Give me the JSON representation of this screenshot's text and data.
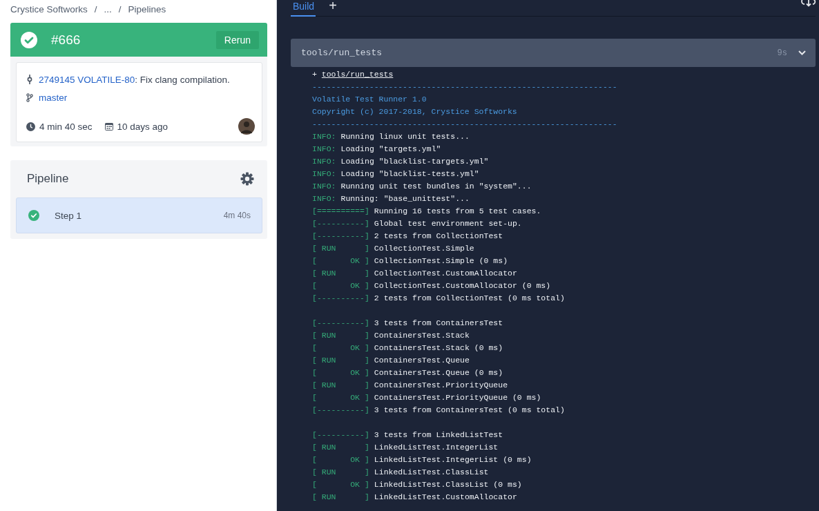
{
  "breadcrumb": [
    "Crystice Softworks",
    "/",
    "...",
    "/",
    "Pipelines"
  ],
  "build": {
    "succeeded": true,
    "number": "#666",
    "rerun": "Rerun",
    "commit_link": "2749145 VOLATILE-80",
    "commit_message": ": Fix clang compilation.",
    "branch": "master",
    "duration": "4 min 40 sec",
    "created": "10 days ago"
  },
  "pipeline": {
    "title": "Pipeline",
    "steps": [
      {
        "name": "Step 1",
        "duration": "4m 40s",
        "succeeded": true,
        "selected": true
      }
    ]
  },
  "tabs": [
    {
      "label": "Build",
      "selected": true
    }
  ],
  "add_tab": "+",
  "section": {
    "command": "tools/run_tests",
    "duration": "9s",
    "expanded": true
  },
  "log": [
    {
      "kind": "command",
      "prefix": "+",
      "text": "tools/run_tests"
    },
    {
      "kind": "rule",
      "text": "----------------------------------------------------------------"
    },
    {
      "kind": "header",
      "text": "Volatile Test Runner 1.0"
    },
    {
      "kind": "header",
      "text": "Copyright (c) 2017-2018, Crystice Softworks"
    },
    {
      "kind": "rule",
      "text": "----------------------------------------------------------------"
    },
    {
      "kind": "info",
      "prefix": "INFO:",
      "text": "Running linux unit tests..."
    },
    {
      "kind": "info",
      "prefix": "INFO:",
      "text": "Loading \"targets.yml\""
    },
    {
      "kind": "info",
      "prefix": "INFO:",
      "text": "Loading \"blacklist-targets.yml\""
    },
    {
      "kind": "info",
      "prefix": "INFO:",
      "text": "Loading \"blacklist-tests.yml\""
    },
    {
      "kind": "info",
      "prefix": "INFO:",
      "text": "Running unit test bundles in \"system\"..."
    },
    {
      "kind": "info",
      "prefix": "INFO:",
      "text": "Running: \"base_unittest\"..."
    },
    {
      "kind": "gtest",
      "prefix": "[==========]",
      "text": "Running 16 tests from 5 test cases."
    },
    {
      "kind": "gtest",
      "prefix": "[----------]",
      "text": "Global test environment set-up."
    },
    {
      "kind": "gtest",
      "prefix": "[----------]",
      "text": "2 tests from CollectionTest"
    },
    {
      "kind": "gtest",
      "prefix": "[ RUN      ]",
      "text": "CollectionTest.Simple"
    },
    {
      "kind": "gtest",
      "prefix": "[       OK ]",
      "text": "CollectionTest.Simple (0 ms)"
    },
    {
      "kind": "gtest",
      "prefix": "[ RUN      ]",
      "text": "CollectionTest.CustomAllocator"
    },
    {
      "kind": "gtest",
      "prefix": "[       OK ]",
      "text": "CollectionTest.CustomAllocator (0 ms)"
    },
    {
      "kind": "gtest",
      "prefix": "[----------]",
      "text": "2 tests from CollectionTest (0 ms total)"
    },
    {
      "kind": "blank"
    },
    {
      "kind": "gtest",
      "prefix": "[----------]",
      "text": "3 tests from ContainersTest"
    },
    {
      "kind": "gtest",
      "prefix": "[ RUN      ]",
      "text": "ContainersTest.Stack"
    },
    {
      "kind": "gtest",
      "prefix": "[       OK ]",
      "text": "ContainersTest.Stack (0 ms)"
    },
    {
      "kind": "gtest",
      "prefix": "[ RUN      ]",
      "text": "ContainersTest.Queue"
    },
    {
      "kind": "gtest",
      "prefix": "[       OK ]",
      "text": "ContainersTest.Queue (0 ms)"
    },
    {
      "kind": "gtest",
      "prefix": "[ RUN      ]",
      "text": "ContainersTest.PriorityQueue"
    },
    {
      "kind": "gtest",
      "prefix": "[       OK ]",
      "text": "ContainersTest.PriorityQueue (0 ms)"
    },
    {
      "kind": "gtest",
      "prefix": "[----------]",
      "text": "3 tests from ContainersTest (0 ms total)"
    },
    {
      "kind": "blank"
    },
    {
      "kind": "gtest",
      "prefix": "[----------]",
      "text": "3 tests from LinkedListTest"
    },
    {
      "kind": "gtest",
      "prefix": "[ RUN      ]",
      "text": "LinkedListTest.IntegerList"
    },
    {
      "kind": "gtest",
      "prefix": "[       OK ]",
      "text": "LinkedListTest.IntegerList (0 ms)"
    },
    {
      "kind": "gtest",
      "prefix": "[ RUN      ]",
      "text": "LinkedListTest.ClassList"
    },
    {
      "kind": "gtest",
      "prefix": "[       OK ]",
      "text": "LinkedListTest.ClassList (0 ms)"
    },
    {
      "kind": "gtest",
      "prefix": "[ RUN      ]",
      "text": "LinkedListTest.CustomAllocator"
    }
  ]
}
